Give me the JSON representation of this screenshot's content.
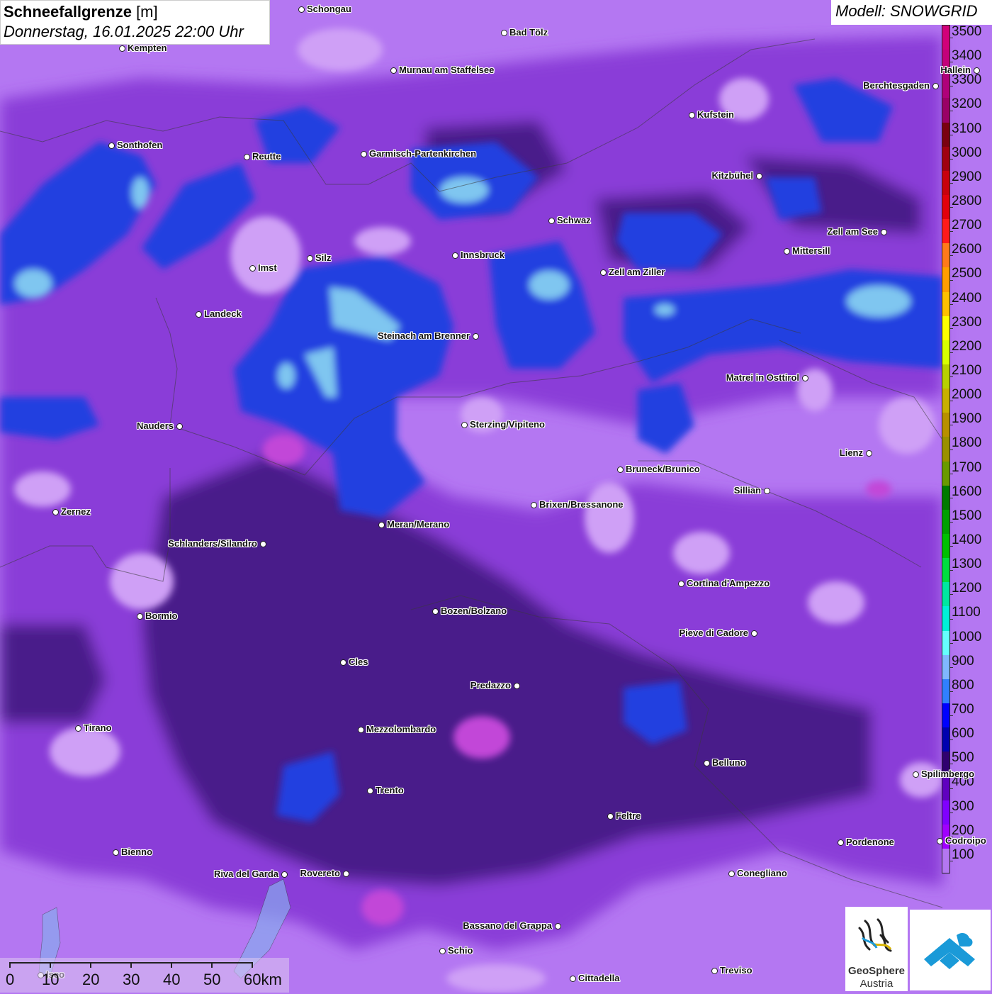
{
  "title": {
    "main_bold": "Schneefallgrenze",
    "main_unit": " [m]",
    "datetime": "Donnerstag, 16.01.2025 22:00 Uhr"
  },
  "model_label": "Modell: SNOWGRID",
  "legend": {
    "labels": [
      "3500",
      "3400",
      "3300",
      "3200",
      "3100",
      "3000",
      "2900",
      "2800",
      "2700",
      "2600",
      "2500",
      "2400",
      "2300",
      "2200",
      "2100",
      "2000",
      "1900",
      "1800",
      "1700",
      "1600",
      "1500",
      "1400",
      "1300",
      "1200",
      "1100",
      "1000",
      "900",
      "800",
      "700",
      "600",
      "500",
      "400",
      "300",
      "200",
      "100"
    ],
    "colors": [
      "#d2007a",
      "#c4007a",
      "#b0007a",
      "#9a0066",
      "#7a0010",
      "#a00010",
      "#c8000c",
      "#e2000c",
      "#ff1a1a",
      "#ff7a1a",
      "#ff9e00",
      "#ffc000",
      "#ffff00",
      "#d8ff00",
      "#b8d000",
      "#c8b000",
      "#b89000",
      "#9a9000",
      "#6a9a00",
      "#007a00",
      "#00a000",
      "#00c000",
      "#00dd40",
      "#00e8a0",
      "#00f0d8",
      "#66ffff",
      "#80b8ff",
      "#3080ff",
      "#0000ff",
      "#0000b0",
      "#300070",
      "#6000c0",
      "#8000ff",
      "#a000ff",
      "#b477f2"
    ]
  },
  "cities": [
    {
      "name": "Schongau",
      "dot": "left"
    },
    {
      "name": "Kempten",
      "dot": "left"
    },
    {
      "name": "Bad Tölz",
      "dot": "left"
    },
    {
      "name": "Murnau am Staffelsee",
      "dot": "left"
    },
    {
      "name": "Hallein",
      "dot": "right"
    },
    {
      "name": "Berchtesgaden",
      "dot": "right"
    },
    {
      "name": "Kufstein",
      "dot": "left"
    },
    {
      "name": "Sonthofen",
      "dot": "left"
    },
    {
      "name": "Reutte",
      "dot": "left"
    },
    {
      "name": "Garmisch-Partenkirchen",
      "dot": "left"
    },
    {
      "name": "Kitzbühel",
      "dot": "right"
    },
    {
      "name": "Schwaz",
      "dot": "left"
    },
    {
      "name": "Zell am See",
      "dot": "right"
    },
    {
      "name": "Mittersill",
      "dot": "left"
    },
    {
      "name": "Innsbruck",
      "dot": "left"
    },
    {
      "name": "Imst",
      "dot": "left"
    },
    {
      "name": "Silz",
      "dot": "left"
    },
    {
      "name": "Zell am Ziller",
      "dot": "left"
    },
    {
      "name": "Landeck",
      "dot": "left"
    },
    {
      "name": "Steinach am Brenner",
      "dot": "right"
    },
    {
      "name": "Matrei in Osttirol",
      "dot": "right"
    },
    {
      "name": "Nauders",
      "dot": "right"
    },
    {
      "name": "Sterzing/Vipiteno",
      "dot": "left"
    },
    {
      "name": "Lienz",
      "dot": "right"
    },
    {
      "name": "Bruneck/Brunico",
      "dot": "left"
    },
    {
      "name": "Sillian",
      "dot": "right"
    },
    {
      "name": "Zernez",
      "dot": "left"
    },
    {
      "name": "Brixen/Bressanone",
      "dot": "left"
    },
    {
      "name": "Meran/Merano",
      "dot": "left"
    },
    {
      "name": "Schlanders/Silandro",
      "dot": "right"
    },
    {
      "name": "Cortina d'Ampezzo",
      "dot": "left"
    },
    {
      "name": "Bormio",
      "dot": "left"
    },
    {
      "name": "Bozen/Bolzano",
      "dot": "left"
    },
    {
      "name": "Pieve di Cadore",
      "dot": "right"
    },
    {
      "name": "Cles",
      "dot": "left"
    },
    {
      "name": "Predazzo",
      "dot": "right"
    },
    {
      "name": "Tirano",
      "dot": "left"
    },
    {
      "name": "Mezzolombardo",
      "dot": "left"
    },
    {
      "name": "Belluno",
      "dot": "left"
    },
    {
      "name": "Spilimbergo",
      "dot": "left"
    },
    {
      "name": "Trento",
      "dot": "left"
    },
    {
      "name": "Feltre",
      "dot": "left"
    },
    {
      "name": "Pordenone",
      "dot": "left"
    },
    {
      "name": "Codroipo",
      "dot": "left"
    },
    {
      "name": "Bienno",
      "dot": "left"
    },
    {
      "name": "Riva del Garda",
      "dot": "right"
    },
    {
      "name": "Rovereto",
      "dot": "right"
    },
    {
      "name": "Conegliano",
      "dot": "left"
    },
    {
      "name": "Bassano del Grappa",
      "dot": "right"
    },
    {
      "name": "Schio",
      "dot": "left"
    },
    {
      "name": "Treviso",
      "dot": "left"
    },
    {
      "name": "Cittadella",
      "dot": "left"
    },
    {
      "name": "Iseo",
      "dot": "left"
    }
  ],
  "scale_bar": {
    "labels": [
      "0",
      "10",
      "20",
      "30",
      "40",
      "50",
      "60km"
    ]
  },
  "logos": {
    "geosphere_line1": "GeoSphere",
    "geosphere_line2": "Austria"
  },
  "colors": {
    "base": "#b477f2",
    "mid": "#8a3ed8",
    "dark": "#4a1b8a",
    "blue": "#2340e0",
    "light_blue": "#7fc6f0",
    "pink": "#c246d8",
    "pale": "#cfa0f6"
  }
}
